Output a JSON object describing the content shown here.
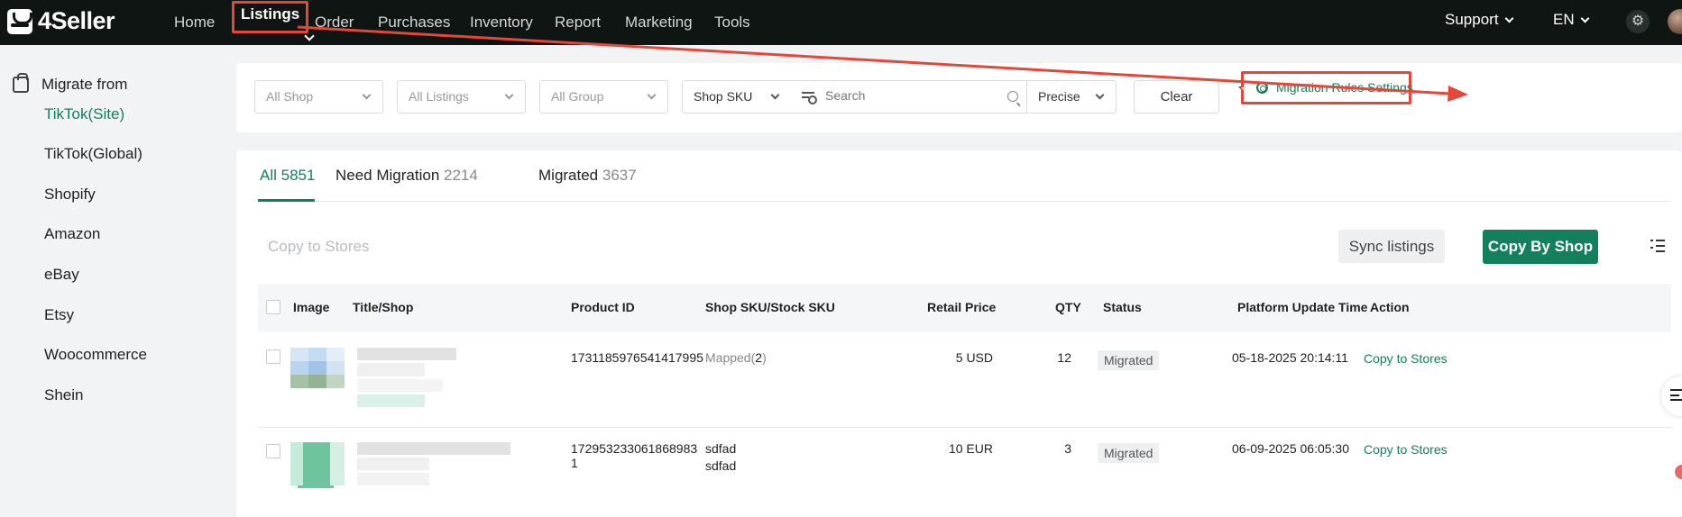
{
  "app": {
    "logo_text": "4Seller"
  },
  "nav": {
    "items": [
      "Home",
      "Listings",
      "Order",
      "Purchases",
      "Inventory",
      "Report",
      "Marketing",
      "Tools"
    ],
    "active": "Listings",
    "support": "Support",
    "language": "EN"
  },
  "sidebar": {
    "title": "Migrate from",
    "items": [
      "TikTok(Site)",
      "TikTok(Global)",
      "Shopify",
      "Amazon",
      "eBay",
      "Etsy",
      "Woocommerce",
      "Shein"
    ],
    "active": "TikTok(Site)"
  },
  "filters": {
    "shop": "All Shop",
    "listings": "All Listings",
    "group": "All Group",
    "sku_type": "Shop SKU",
    "search_placeholder": "Search",
    "match_mode": "Precise",
    "clear_label": "Clear",
    "rules_label": "Migration Rules Settings"
  },
  "tabs": [
    {
      "label": "All",
      "count": "5851"
    },
    {
      "label": "Need Migration",
      "count": "2214"
    },
    {
      "label": "Migrated",
      "count": "3637"
    }
  ],
  "toolbar": {
    "copy_to_stores": "Copy to Stores",
    "sync_listings": "Sync listings",
    "copy_by_shop": "Copy By Shop"
  },
  "table": {
    "columns": [
      "Image",
      "Title/Shop",
      "Product ID",
      "Shop SKU/Stock SKU",
      "Retail Price",
      "QTY",
      "Status",
      "Platform Update Time",
      "Action"
    ],
    "rows": [
      {
        "product_id": "1731185976541417995",
        "product_id_wrap": "",
        "sku_line1": "Mapped(",
        "sku_count": "2",
        "sku_close": ")",
        "sku_line2": "",
        "price": "5 USD",
        "qty": "12",
        "status": "Migrated",
        "update_time": "05-18-2025 20:14:11",
        "action": "Copy to Stores"
      },
      {
        "product_id": "172953233061868983",
        "product_id_wrap": "1",
        "sku_line1": "sdfad",
        "sku_count": "",
        "sku_close": "",
        "sku_line2": "sdfad",
        "price": "10 EUR",
        "qty": "3",
        "status": "Migrated",
        "update_time": "06-09-2025 06:05:30",
        "action": "Copy to Stores"
      }
    ]
  },
  "colors": {
    "accent": "#12805c",
    "annotation": "#e5463a",
    "topbar": "#0f1512"
  }
}
